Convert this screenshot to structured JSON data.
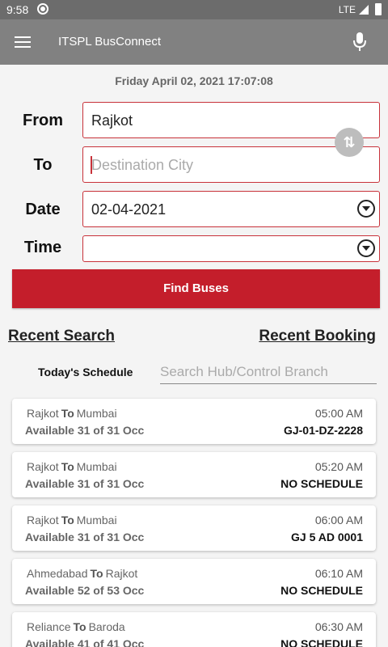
{
  "status_bar": {
    "time": "9:58",
    "network": "LTE"
  },
  "app_bar": {
    "title": "ITSPL BusConnect"
  },
  "datetime": "Friday April 02, 2021 17:07:08",
  "form": {
    "from_label": "From",
    "from_value": "Rajkot",
    "to_label": "To",
    "to_placeholder": "Destination City",
    "date_label": "Date",
    "date_value": "02-04-2021",
    "time_label": "Time",
    "time_value": ""
  },
  "find_button": "Find Buses",
  "tabs": {
    "recent_search": "Recent Search",
    "recent_booking": "Recent Booking"
  },
  "schedule": {
    "label": "Today's Schedule",
    "search_placeholder": "Search Hub/Control Branch"
  },
  "trips": [
    {
      "from": "Rajkot",
      "connector": "To",
      "to": "Mumbai",
      "availability": "Available 31 of 31 Occ",
      "time": "05:00 AM",
      "bus": "GJ-01-DZ-2228"
    },
    {
      "from": "Rajkot",
      "connector": "To",
      "to": "Mumbai",
      "availability": "Available 31 of 31 Occ",
      "time": "05:20 AM",
      "bus": "NO SCHEDULE"
    },
    {
      "from": "Rajkot",
      "connector": "To",
      "to": "Mumbai",
      "availability": "Available 31 of 31 Occ",
      "time": "06:00 AM",
      "bus": "GJ 5 AD 0001"
    },
    {
      "from": "Ahmedabad",
      "connector": "To",
      "to": "Rajkot",
      "availability": "Available 52 of 53 Occ",
      "time": "06:10 AM",
      "bus": "NO SCHEDULE"
    },
    {
      "from": "Reliance",
      "connector": "To",
      "to": "Baroda",
      "availability": "Available 41 of 41 Occ",
      "time": "06:30 AM",
      "bus": "NO SCHEDULE"
    }
  ],
  "colors": {
    "accent": "#c41e2b",
    "app_bar": "#818181",
    "status_bar": "#6c6c6c"
  }
}
